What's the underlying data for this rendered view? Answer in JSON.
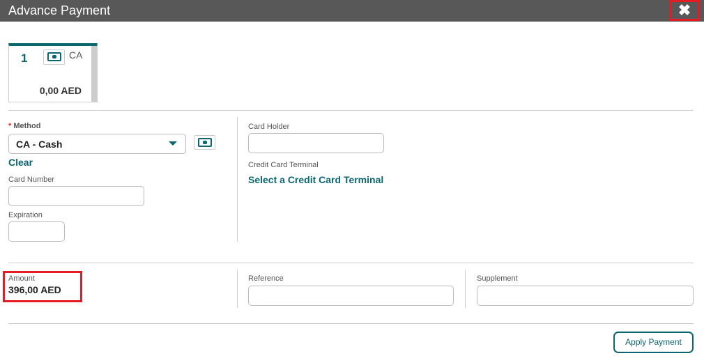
{
  "title": "Advance Payment",
  "close_icon": "close-icon",
  "payment_card": {
    "number": "1",
    "code": "CA",
    "amount": "0,00 AED",
    "icon": "cash-icon"
  },
  "method": {
    "label": "Method",
    "required": "*",
    "value": "CA - Cash",
    "clear": "Clear"
  },
  "card_number": {
    "label": "Card Number",
    "value": ""
  },
  "expiration": {
    "label": "Expiration",
    "value": ""
  },
  "card_holder": {
    "label": "Card Holder",
    "value": ""
  },
  "terminal": {
    "label": "Credit Card Terminal",
    "link": "Select a Credit Card Terminal"
  },
  "amount": {
    "label": "Amount",
    "value": "396,00 AED"
  },
  "reference": {
    "label": "Reference",
    "value": ""
  },
  "supplement": {
    "label": "Supplement",
    "value": ""
  },
  "apply_label": "Apply Payment",
  "colors": {
    "accent": "#0b6670",
    "header": "#585858",
    "highlight": "#e41b23"
  }
}
